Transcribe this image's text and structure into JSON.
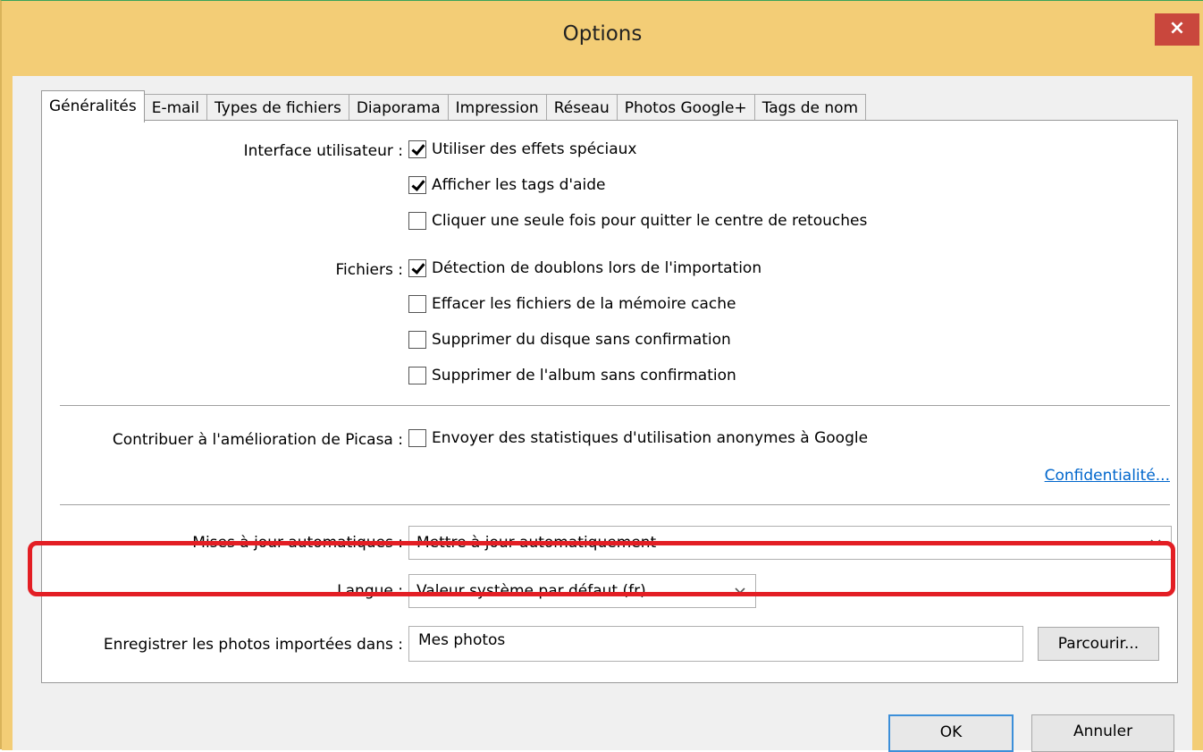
{
  "window": {
    "title": "Options",
    "close_symbol": "×"
  },
  "tabs": [
    {
      "label": "Généralités",
      "active": true
    },
    {
      "label": "E-mail"
    },
    {
      "label": "Types de fichiers"
    },
    {
      "label": "Diaporama"
    },
    {
      "label": "Impression"
    },
    {
      "label": "Réseau"
    },
    {
      "label": "Photos Google+"
    },
    {
      "label": "Tags de nom"
    }
  ],
  "interface": {
    "label": "Interface utilisateur :",
    "options": [
      {
        "label": "Utiliser des effets spéciaux",
        "checked": true
      },
      {
        "label": "Afficher les tags d'aide",
        "checked": true
      },
      {
        "label": "Cliquer une seule fois pour quitter le centre de retouches",
        "checked": false
      }
    ]
  },
  "files": {
    "label": "Fichiers :",
    "options": [
      {
        "label": "Détection de doublons lors de l'importation",
        "checked": true
      },
      {
        "label": "Effacer les fichiers de la mémoire cache",
        "checked": false
      },
      {
        "label": "Supprimer du disque sans confirmation",
        "checked": false
      },
      {
        "label": "Supprimer de l'album sans confirmation",
        "checked": false
      }
    ]
  },
  "contribute": {
    "label": "Contribuer à l'amélioration de Picasa :",
    "option": {
      "label": "Envoyer des statistiques d'utilisation anonymes à Google",
      "checked": false
    },
    "privacy_link": "Confidentialité..."
  },
  "updates": {
    "label": "Mises à jour automatiques :",
    "value": "Mettre à jour automatiquement"
  },
  "language": {
    "label": "Langue :",
    "value": "Valeur système par défaut (fr)"
  },
  "save_location": {
    "label": "Enregistrer les photos importées dans :",
    "value": "Mes photos",
    "browse_label": "Parcourir..."
  },
  "footer": {
    "ok_label": "OK",
    "cancel_label": "Annuler"
  },
  "colors": {
    "titlebar": "#f3cd76",
    "close_button": "#c9473d",
    "highlight": "#e31e24",
    "link": "#0066cc",
    "default_button_border": "#3c8fd9"
  }
}
